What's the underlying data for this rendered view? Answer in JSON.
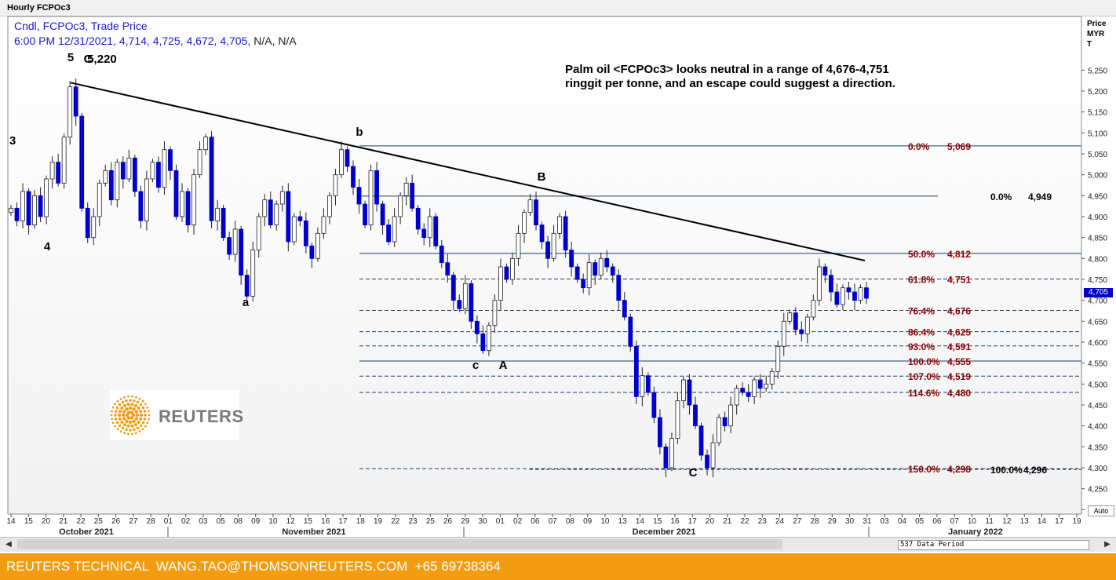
{
  "window_title": "Hourly FCPOc3",
  "info": {
    "line1": "Cndl, FCPOc3, Trade Price",
    "line2": "6:00 PM 12/31/2021, 4,714, 4,725, 4,672, 4,705,",
    "line2_na": "N/A, N/A"
  },
  "annotation": {
    "line1": "Palm oil <FCPOc3> looks neutral in a range of 4,676-4,751",
    "line2": "ringgit per tonne, and an escape could suggest a direction."
  },
  "axis": {
    "price_label": [
      "Price",
      "MYR",
      "T"
    ],
    "current_price": "4,705",
    "auto_button": "Auto"
  },
  "scroll": {
    "data_period": "537 Data Period",
    "left_arrow": "◀",
    "right_arrow": "▶"
  },
  "logo": {
    "text": "REUTERS"
  },
  "footer": {
    "text": "REUTERS TECHNICAL  WANG.TAO@THOMSONREUTERS.COM  +65 69738364"
  },
  "colors": {
    "candle": "#0000cc",
    "fib_text": "#8b0000",
    "fib_line": "#1a3d66",
    "footer": "#f39c12"
  },
  "chart_data": {
    "type": "candlestick",
    "title": "Hourly FCPOc3",
    "ylabel": "Price MYR T",
    "ylim": [
      4180,
      5300
    ],
    "y_ticks": [
      4200,
      4250,
      4300,
      4350,
      4400,
      4450,
      4500,
      4550,
      4600,
      4650,
      4700,
      4750,
      4800,
      4850,
      4900,
      4950,
      5000,
      5050,
      5100,
      5150,
      5200,
      5250
    ],
    "y_tick_labels": [
      "4,200",
      "4,250",
      "4,300",
      "4,350",
      "4,400",
      "4,450",
      "4,500",
      "4,550",
      "4,600",
      "4,650",
      "4,700",
      "4,750",
      "4,800",
      "4,850",
      "4,900",
      "4,950",
      "5,000",
      "5,050",
      "5,100",
      "5,150",
      "5,200",
      "5,250"
    ],
    "x_day_labels": [
      "14",
      "15",
      "20",
      "21",
      "22",
      "25",
      "26",
      "27",
      "28",
      "01",
      "02",
      "03",
      "05",
      "08",
      "09",
      "10",
      "12",
      "15",
      "16",
      "17",
      "18",
      "19",
      "22",
      "23",
      "25",
      "26",
      "29",
      "30",
      "01",
      "02",
      "06",
      "07",
      "08",
      "09",
      "10",
      "13",
      "14",
      "15",
      "16",
      "17",
      "20",
      "21",
      "22",
      "23",
      "24",
      "27",
      "28",
      "29",
      "30",
      "31",
      "03",
      "04",
      "05",
      "06",
      "07",
      "10",
      "11",
      "12",
      "13",
      "14",
      "17",
      "19"
    ],
    "x_month_labels": [
      "October 2021",
      "November 2021",
      "December 2021",
      "January 2022"
    ],
    "candle_closes": [
      4920,
      4890,
      4960,
      4880,
      4950,
      4900,
      4990,
      5030,
      4980,
      5090,
      5210,
      5140,
      4920,
      4850,
      4900,
      4980,
      5010,
      4940,
      5030,
      4990,
      5040,
      4960,
      4890,
      4990,
      5030,
      4970,
      5060,
      5010,
      4900,
      4960,
      4880,
      5000,
      5060,
      5090,
      4890,
      4920,
      4850,
      4810,
      4870,
      4760,
      4710,
      4820,
      4900,
      4940,
      4880,
      4930,
      4960,
      4840,
      4900,
      4890,
      4830,
      4800,
      4860,
      4900,
      4950,
      5000,
      5060,
      5020,
      4970,
      4930,
      4880,
      5010,
      4930,
      4880,
      4840,
      4900,
      4950,
      4980,
      4920,
      4870,
      4850,
      4900,
      4830,
      4790,
      4760,
      4700,
      4680,
      4740,
      4650,
      4620,
      4580,
      4640,
      4700,
      4780,
      4750,
      4800,
      4860,
      4910,
      4940,
      4880,
      4840,
      4800,
      4860,
      4900,
      4820,
      4780,
      4750,
      4730,
      4790,
      4760,
      4800,
      4780,
      4760,
      4700,
      4660,
      4590,
      4470,
      4520,
      4480,
      4420,
      4350,
      4300,
      4370,
      4460,
      4510,
      4450,
      4400,
      4330,
      4300,
      4360,
      4420,
      4400,
      4450,
      4490,
      4480,
      4470,
      4510,
      4490,
      4500,
      4530,
      4590,
      4650,
      4670,
      4630,
      4620,
      4660,
      4700,
      4780,
      4760,
      4720,
      4690,
      4730,
      4720,
      4700,
      4730,
      4705
    ],
    "wave_labels": [
      "5",
      "C",
      "5,220",
      "3",
      "4",
      "a",
      "b",
      "c",
      "A",
      "B",
      "C"
    ],
    "trendline": {
      "from_price": 5220,
      "to_price": 4795
    },
    "fib_levels": [
      {
        "pct": "0.0%",
        "value": "5,069",
        "price": 5069,
        "style": "solid"
      },
      {
        "pct": "50.0%",
        "value": "4,812",
        "price": 4812,
        "style": "solid"
      },
      {
        "pct": "61.8%",
        "value": "4,751",
        "price": 4751,
        "style": "dashed"
      },
      {
        "pct": "76.4%",
        "value": "4,676",
        "price": 4676,
        "style": "dashed"
      },
      {
        "pct": "86.4%",
        "value": "4,625",
        "price": 4625,
        "style": "dashed"
      },
      {
        "pct": "93.0%",
        "value": "4,591",
        "price": 4591,
        "style": "dashed"
      },
      {
        "pct": "100.0%",
        "value": "4,555",
        "price": 4555,
        "style": "solid"
      },
      {
        "pct": "107.0%",
        "value": "4,519",
        "price": 4519,
        "style": "dashed"
      },
      {
        "pct": "114.6%",
        "value": "4,480",
        "price": 4480,
        "style": "dashed"
      },
      {
        "pct": "150.0%",
        "value": "4,298",
        "price": 4298,
        "style": "dashed"
      }
    ],
    "fib_levels_2": [
      {
        "pct": "0.0%",
        "value": "4,949",
        "price": 4949
      },
      {
        "pct": "100.0%",
        "value": "4,296",
        "price": 4296
      }
    ]
  }
}
